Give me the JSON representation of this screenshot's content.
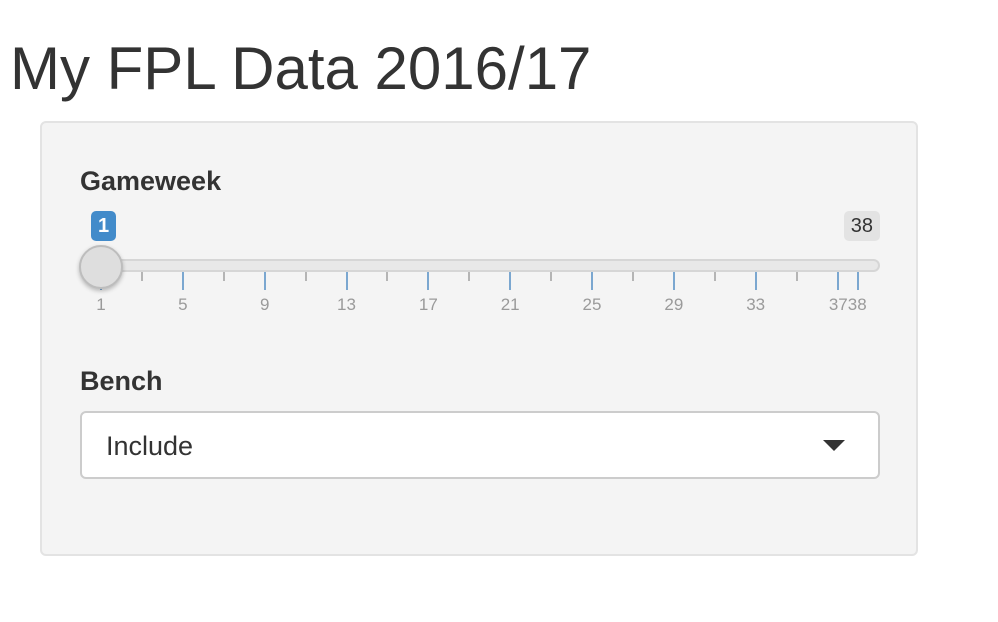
{
  "page": {
    "title": "My FPL Data 2016/17"
  },
  "gameweek": {
    "label": "Gameweek",
    "min": 1,
    "max": 38,
    "value": 1,
    "value_label": "1",
    "max_label": "38",
    "tick_labels": [
      "1",
      "5",
      "9",
      "13",
      "17",
      "21",
      "25",
      "29",
      "33",
      "3738"
    ],
    "accent_color": "#428bca"
  },
  "bench": {
    "label": "Bench",
    "selected": "Include",
    "caret_icon": "caret-down-icon"
  }
}
